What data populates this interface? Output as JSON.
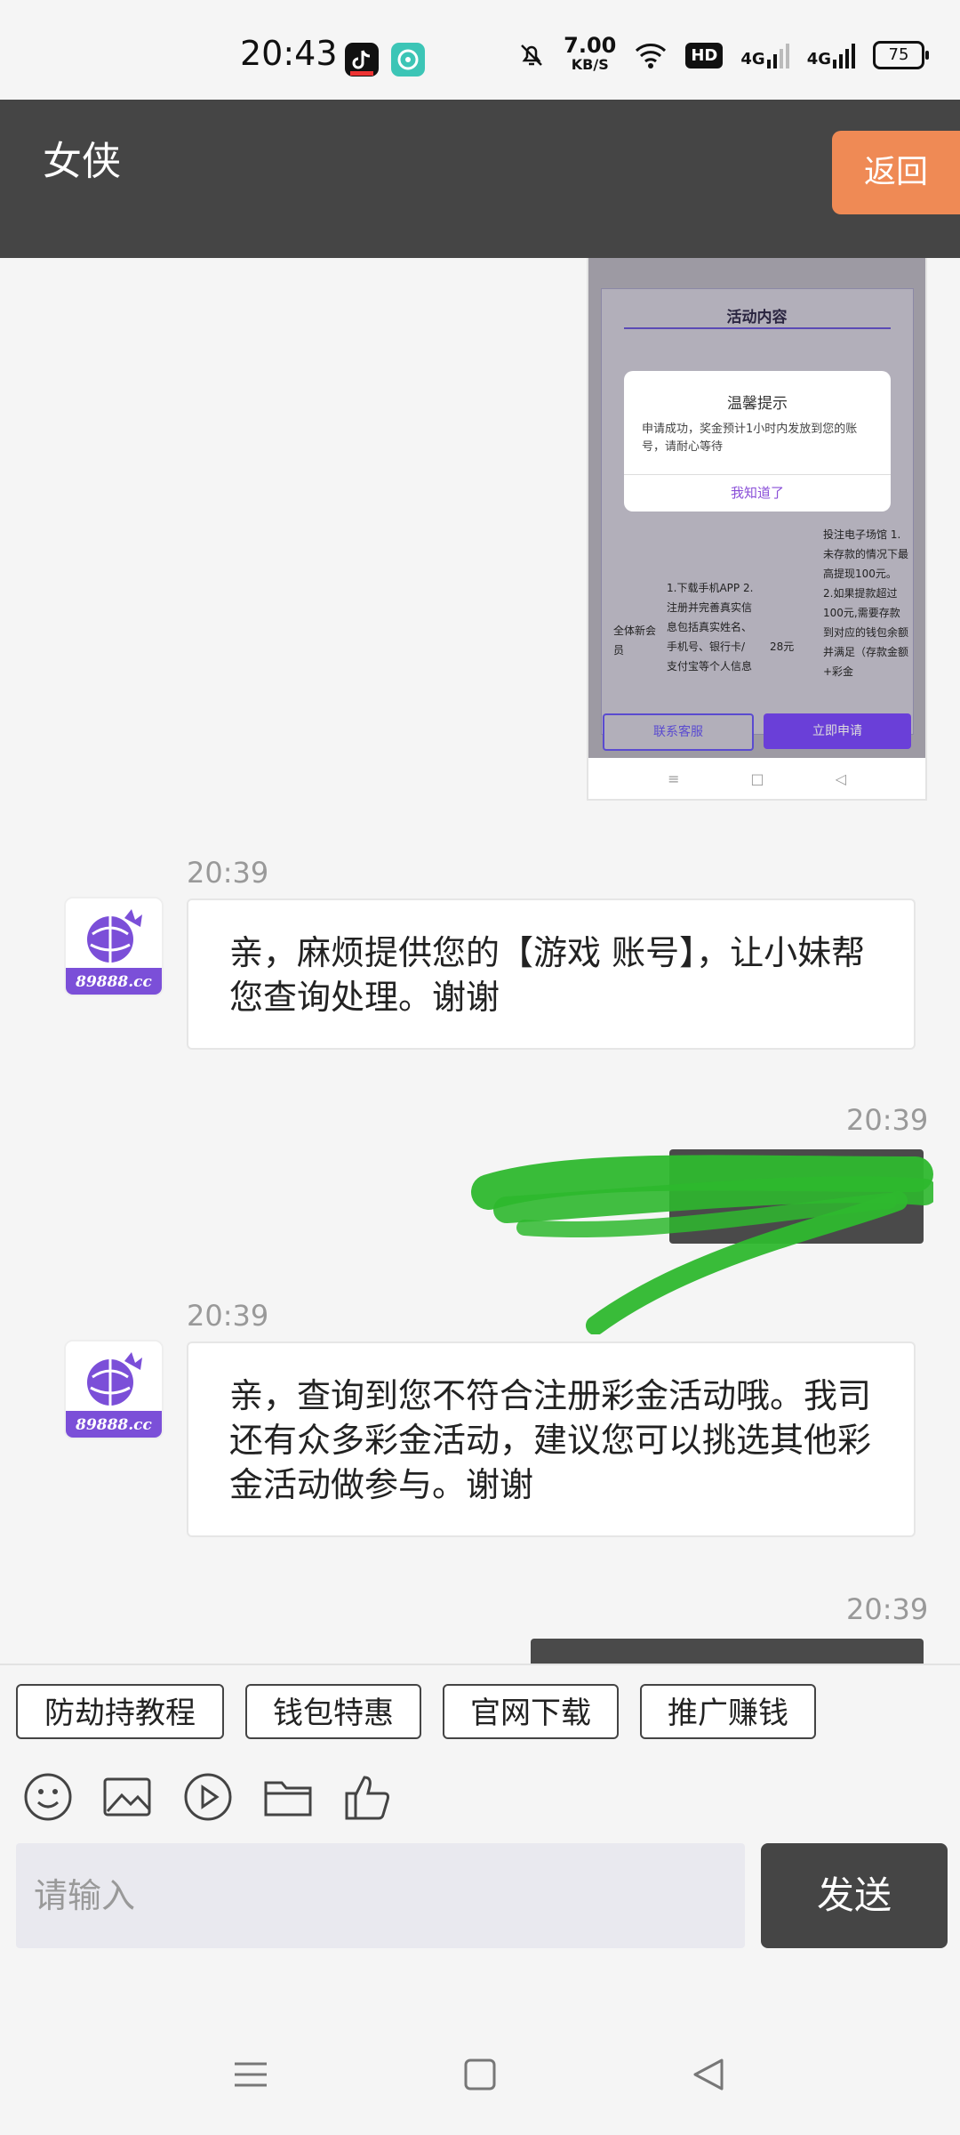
{
  "status_bar": {
    "time": "20:43",
    "speed_value": "7.00",
    "speed_unit": "KB/S",
    "hd_label": "HD",
    "network_1": "4G",
    "network_2": "4G",
    "battery": "75",
    "icons": [
      "tiktok-app-icon",
      "chat-app-icon",
      "bell-muted-icon",
      "wifi-icon",
      "signal-icon",
      "battery-icon"
    ]
  },
  "header": {
    "title": "女侠",
    "back_label": "返回"
  },
  "shared_image": {
    "heading": "活动内容",
    "dialog_title": "温馨提示",
    "dialog_body": "申请成功，奖金预计1小时内发放到您的账号，请耐心等待",
    "dialog_ok": "我知道了",
    "col1": "全体新会员",
    "col2": "1.下载手机APP 2.注册并完善真实信息包括真实姓名、手机号、银行卡/支付宝等个人信息",
    "col3": "28元",
    "col4": "投注电子场馆 1.未存款的情况下最高提现100元。 2.如果提款超过100元,需要存款到对应的钱包余额并满足（存款金额+彩金",
    "contact_btn": "联系客服",
    "apply_btn": "立即申请"
  },
  "messages": [
    {
      "time": "20:39",
      "text": "亲，麻烦提供您的【游戏 账号】，让小妹帮您查询处理。谢谢"
    },
    {
      "time": "20:39",
      "text": ""
    },
    {
      "time": "20:39",
      "text": "亲，查询到您不符合注册彩金活动哦。我司还有众多彩金活动，建议您可以挑选其他彩金活动做参与。谢谢"
    },
    {
      "time": "20:39",
      "text": ""
    }
  ],
  "avatar_text": "89888.cc",
  "quick_buttons": [
    "防劫持教程",
    "钱包特惠",
    "官网下载",
    "推广赚钱"
  ],
  "toolbar_icons": [
    "emoji-icon",
    "image-icon",
    "video-icon",
    "folder-icon",
    "thumbs-up-icon"
  ],
  "input": {
    "placeholder": "请输入"
  },
  "send_label": "发送",
  "colors": {
    "header": "#454545",
    "back_button": "#ef8a55",
    "scribble": "#2eb82e",
    "brand_purple": "#7b4fd8"
  }
}
